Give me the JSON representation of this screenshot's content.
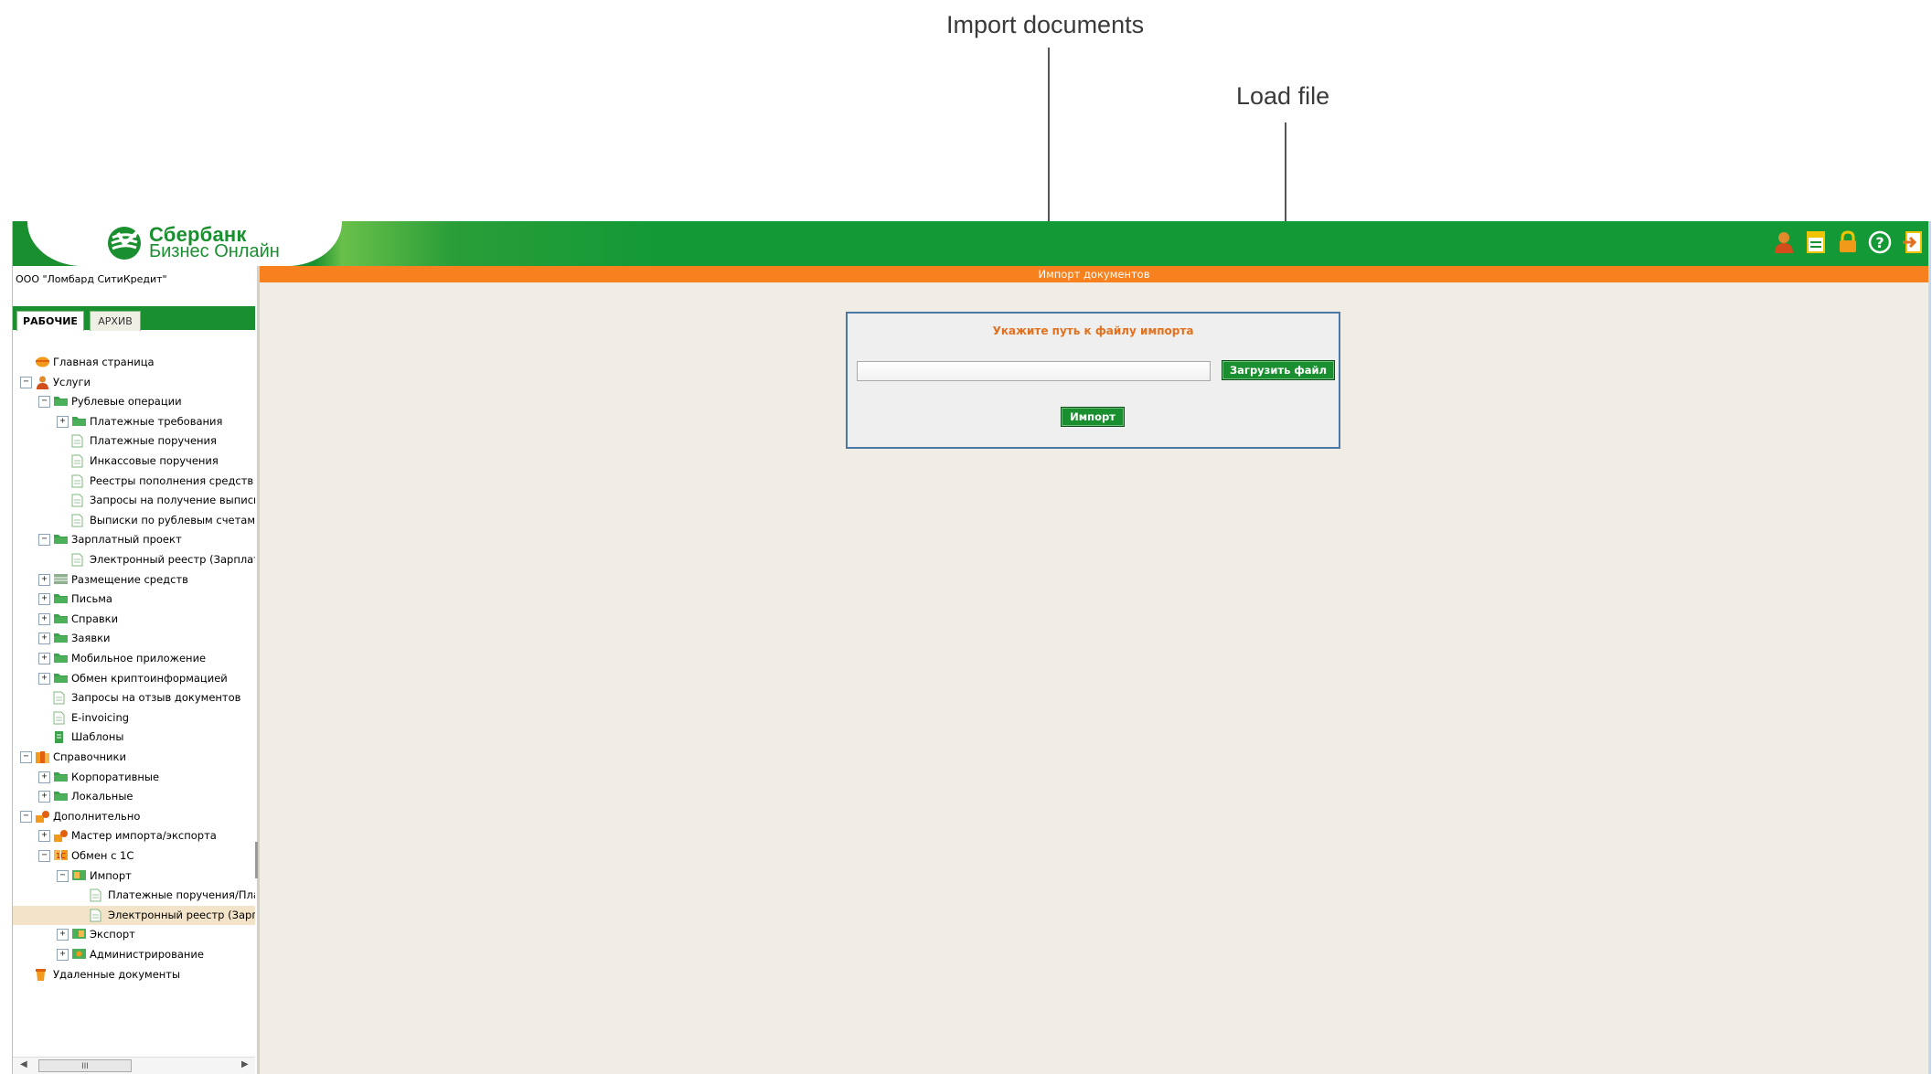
{
  "annotations": {
    "import_documents": "Import documents",
    "load_file": "Load file"
  },
  "header": {
    "logo_line1": "Сбербанк",
    "logo_line2": "Бизнес Онлайн",
    "icons": [
      "user-icon",
      "document-icon",
      "lock-icon",
      "help-icon",
      "exit-icon"
    ]
  },
  "sidebar": {
    "organization": "ООО \"Ломбард СитиКредит\"",
    "tabs": [
      {
        "label": "РАБОЧИЕ",
        "active": true
      },
      {
        "label": "АРХИВ",
        "active": false
      }
    ],
    "tree": [
      {
        "label": "Главная страница",
        "level": 0,
        "toggle": "",
        "icon": "home-icon"
      },
      {
        "label": "Услуги",
        "level": 0,
        "toggle": "−",
        "icon": "person-icon"
      },
      {
        "label": "Рублевые операции",
        "level": 1,
        "toggle": "−",
        "icon": "folder-icon"
      },
      {
        "label": "Платежные требования",
        "level": 2,
        "toggle": "+",
        "icon": "folder-icon"
      },
      {
        "label": "Платежные поручения",
        "level": 2,
        "toggle": "",
        "icon": "document-icon"
      },
      {
        "label": "Инкассовые поручения",
        "level": 2,
        "toggle": "",
        "icon": "document-icon"
      },
      {
        "label": "Реестры пополнения средств по",
        "level": 2,
        "toggle": "",
        "icon": "document-icon"
      },
      {
        "label": "Запросы на получение выписки п",
        "level": 2,
        "toggle": "",
        "icon": "document-icon"
      },
      {
        "label": "Выписки по рублевым счетам",
        "level": 2,
        "toggle": "",
        "icon": "document-icon"
      },
      {
        "label": "Зарплатный проект",
        "level": 1,
        "toggle": "−",
        "icon": "folder-icon"
      },
      {
        "label": "Электронный реестр (Зарплатн",
        "level": 2,
        "toggle": "",
        "icon": "document-icon"
      },
      {
        "label": "Размещение средств",
        "level": 1,
        "toggle": "+",
        "icon": "grid-icon"
      },
      {
        "label": "Письма",
        "level": 1,
        "toggle": "+",
        "icon": "folder-icon"
      },
      {
        "label": "Справки",
        "level": 1,
        "toggle": "+",
        "icon": "folder-icon"
      },
      {
        "label": "Заявки",
        "level": 1,
        "toggle": "+",
        "icon": "folder-icon"
      },
      {
        "label": "Мобильное приложение",
        "level": 1,
        "toggle": "+",
        "icon": "folder-icon"
      },
      {
        "label": "Обмен криптоинформацией",
        "level": 1,
        "toggle": "+",
        "icon": "folder-icon"
      },
      {
        "label": "Запросы на отзыв документов",
        "level": 1,
        "toggle": "",
        "icon": "document-icon"
      },
      {
        "label": "E-invoicing",
        "level": 1,
        "toggle": "",
        "icon": "document-icon"
      },
      {
        "label": "Шаблоны",
        "level": 1,
        "toggle": "",
        "icon": "template-icon"
      },
      {
        "label": "Справочники",
        "level": 0,
        "toggle": "−",
        "icon": "books-icon"
      },
      {
        "label": "Корпоративные",
        "level": 1,
        "toggle": "+",
        "icon": "folder-icon"
      },
      {
        "label": "Локальные",
        "level": 1,
        "toggle": "+",
        "icon": "folder-icon"
      },
      {
        "label": "Дополнительно",
        "level": 0,
        "toggle": "−",
        "icon": "tools-icon"
      },
      {
        "label": "Мастер импорта/экспорта",
        "level": 1,
        "toggle": "+",
        "icon": "tools-icon"
      },
      {
        "label": "Обмен с 1С",
        "level": 1,
        "toggle": "−",
        "icon": "exchange-icon"
      },
      {
        "label": "Импорт",
        "level": 2,
        "toggle": "−",
        "icon": "import-icon"
      },
      {
        "label": "Платежные поручения/Плате",
        "level": 3,
        "toggle": "",
        "icon": "document-icon"
      },
      {
        "label": "Электронный реестр (Зарпл",
        "level": 3,
        "toggle": "",
        "icon": "document-icon",
        "selected": true
      },
      {
        "label": "Экспорт",
        "level": 2,
        "toggle": "+",
        "icon": "export-icon"
      },
      {
        "label": "Администрирование",
        "level": 2,
        "toggle": "+",
        "icon": "admin-icon"
      },
      {
        "label": "Удаленные документы",
        "level": 0,
        "toggle": "",
        "icon": "trash-icon"
      }
    ],
    "scrollbar_thumb": "III"
  },
  "main": {
    "title": "Импорт документов",
    "panel": {
      "title": "Укажите путь к файлу импорта",
      "file_value": "",
      "load_button": "Загрузить файл",
      "import_button": "Импорт"
    }
  },
  "colors": {
    "brand_green": "#1a8f30",
    "title_orange": "#f7801f",
    "panel_border": "#4c78a8",
    "selected_row": "#f3e3c9"
  }
}
